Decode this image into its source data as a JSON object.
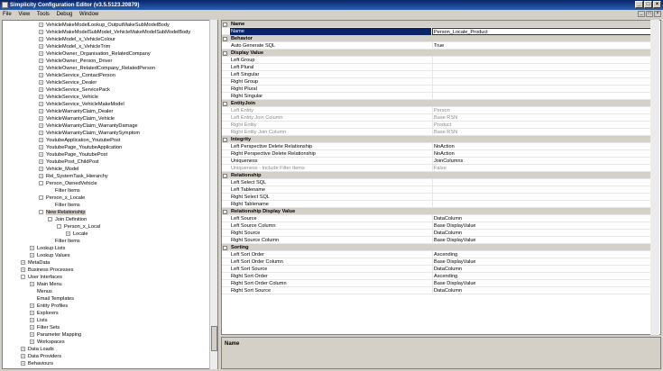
{
  "window": {
    "title": "Simplicity Configuration Editor (v3.5.5123.20879)"
  },
  "menu": [
    "File",
    "View",
    "Tools",
    "Debug",
    "Window"
  ],
  "tree": [
    {
      "label": "VehicleMakeModelLookup_OutputMakeSubModelBody",
      "indent": 2,
      "exp": "+"
    },
    {
      "label": "VehicleMakeModelSubModel_VehicleMakeModelSubModelBody",
      "indent": 2,
      "exp": "+"
    },
    {
      "label": "VehicleModel_x_VehicleColour",
      "indent": 2,
      "exp": "+"
    },
    {
      "label": "VehicleModel_x_VehicleTrim",
      "indent": 2,
      "exp": "+"
    },
    {
      "label": "VehicleOwner_Organisation_RelatedCompany",
      "indent": 2,
      "exp": "+"
    },
    {
      "label": "VehicleOwner_Person_Driver",
      "indent": 2,
      "exp": "+"
    },
    {
      "label": "VehicleOwner_RelatedCompany_RelatedPerson",
      "indent": 2,
      "exp": "+"
    },
    {
      "label": "VehicleService_ContactPerson",
      "indent": 2,
      "exp": "+"
    },
    {
      "label": "VehicleService_Dealer",
      "indent": 2,
      "exp": "+"
    },
    {
      "label": "VehicleService_ServicePack",
      "indent": 2,
      "exp": "+"
    },
    {
      "label": "VehicleService_Vehicle",
      "indent": 2,
      "exp": "+"
    },
    {
      "label": "VehicleService_VehicleMakeModel",
      "indent": 2,
      "exp": "+"
    },
    {
      "label": "VehicleWarrantyClaim_Dealer",
      "indent": 2,
      "exp": "+"
    },
    {
      "label": "VehicleWarrantyClaim_Vehicle",
      "indent": 2,
      "exp": "+"
    },
    {
      "label": "VehicleWarrantyClaim_WarrantyDamage",
      "indent": 2,
      "exp": "+"
    },
    {
      "label": "VehicleWarrantyClaim_WarrantySymptom",
      "indent": 2,
      "exp": "+"
    },
    {
      "label": "YoutubeApplication_YoutubePost",
      "indent": 2,
      "exp": "+"
    },
    {
      "label": "YoutubePage_YoutubeApplication",
      "indent": 2,
      "exp": "+"
    },
    {
      "label": "YoutubePage_YoutubePost",
      "indent": 2,
      "exp": "+"
    },
    {
      "label": "YoutubePost_ChildPost",
      "indent": 2,
      "exp": "+"
    },
    {
      "label": "Vehicle_Model",
      "indent": 2,
      "exp": "+"
    },
    {
      "label": "Rel_SystemTask_Hierarchy",
      "indent": 2,
      "exp": "+"
    },
    {
      "label": "Person_OwnedVehicle",
      "indent": 2,
      "exp": "-"
    },
    {
      "label": "Filter Items",
      "indent": 3,
      "exp": ""
    },
    {
      "label": "Person_x_Locale",
      "indent": 2,
      "exp": "-"
    },
    {
      "label": "Filter Items",
      "indent": 3,
      "exp": ""
    },
    {
      "label": "New Relationship",
      "indent": 2,
      "exp": "-",
      "sel": true
    },
    {
      "label": "Join Definition",
      "indent": 3,
      "exp": "-"
    },
    {
      "label": "Person_x_Local",
      "indent": 4,
      "exp": "-"
    },
    {
      "label": "Locale",
      "indent": 5,
      "exp": "+"
    },
    {
      "label": "Filter Items",
      "indent": 3,
      "exp": ""
    },
    {
      "label": "Lookup Lists",
      "indent": 1,
      "exp": "+"
    },
    {
      "label": "Lookup Values",
      "indent": 1,
      "exp": "+"
    },
    {
      "label": "MetaData",
      "indent": 0,
      "exp": "+"
    },
    {
      "label": "Business Processes",
      "indent": 0,
      "exp": "+"
    },
    {
      "label": "User Interfaces",
      "indent": 0,
      "exp": "-"
    },
    {
      "label": "Main Menu",
      "indent": 1,
      "exp": "+"
    },
    {
      "label": "Menus",
      "indent": 1,
      "exp": ""
    },
    {
      "label": "Email Templates",
      "indent": 1,
      "exp": ""
    },
    {
      "label": "Entity Profiles",
      "indent": 1,
      "exp": "+"
    },
    {
      "label": "Explorers",
      "indent": 1,
      "exp": "+"
    },
    {
      "label": "Lists",
      "indent": 1,
      "exp": "+"
    },
    {
      "label": "Filter Sets",
      "indent": 1,
      "exp": "+"
    },
    {
      "label": "Parameter Mapping",
      "indent": 1,
      "exp": "+"
    },
    {
      "label": "Workspaces",
      "indent": 1,
      "exp": "+"
    },
    {
      "label": "Data Loads",
      "indent": 0,
      "exp": "+"
    },
    {
      "label": "Data Providers",
      "indent": 0,
      "exp": "+"
    },
    {
      "label": "Behaviours",
      "indent": 0,
      "exp": "+"
    }
  ],
  "grid": [
    {
      "type": "cat",
      "key": "Name"
    },
    {
      "key": "Name",
      "value": "Person_Locale_Product",
      "hl": true
    },
    {
      "type": "cat",
      "key": "Behavior"
    },
    {
      "key": "Auto Generate SQL",
      "value": "True"
    },
    {
      "type": "cat",
      "key": "Display Value"
    },
    {
      "key": "Left Group",
      "value": ""
    },
    {
      "key": "Left Plural",
      "value": ""
    },
    {
      "key": "Left Singular",
      "value": ""
    },
    {
      "key": "Right Group",
      "value": ""
    },
    {
      "key": "Right Plural",
      "value": ""
    },
    {
      "key": "Right Singular",
      "value": ""
    },
    {
      "type": "cat",
      "key": "EntityJoin"
    },
    {
      "key": "Left Entity",
      "value": "Person",
      "dim": true
    },
    {
      "key": "Left Entity Join Column",
      "value": "Base RSN",
      "dim": true
    },
    {
      "key": "Right Entity",
      "value": "Product",
      "dim": true
    },
    {
      "key": "Right Entity Join Column",
      "value": "Base RSN",
      "dim": true
    },
    {
      "type": "cat",
      "key": "Integrity"
    },
    {
      "key": "Left Perspective Delete Relationship",
      "value": "NoAction"
    },
    {
      "key": "Right Perspective Delete Relationship",
      "value": "NoAction"
    },
    {
      "key": "Uniqueness",
      "value": "JoinColumns"
    },
    {
      "key": "Uniqueness - Include Filter Items",
      "value": "False",
      "dim": true
    },
    {
      "type": "cat",
      "key": "Relationship"
    },
    {
      "key": "Left Select SQL",
      "value": ""
    },
    {
      "key": "Left Tablename",
      "value": ""
    },
    {
      "key": "Right Select SQL",
      "value": ""
    },
    {
      "key": "Right Tablename",
      "value": ""
    },
    {
      "type": "cat",
      "key": "Relationship Display Value"
    },
    {
      "key": "Left Source",
      "value": "DataColumn"
    },
    {
      "key": "Left Source Column",
      "value": "Base DisplayValue"
    },
    {
      "key": "Right Source",
      "value": "DataColumn"
    },
    {
      "key": "Right Source Column",
      "value": "Base DisplayValue"
    },
    {
      "type": "cat",
      "key": "Sorting"
    },
    {
      "key": "Left Sort Order",
      "value": "Ascending"
    },
    {
      "key": "Left Sort Order Column",
      "value": "Base DisplayValue"
    },
    {
      "key": "Left Sort Source",
      "value": "DataColumn"
    },
    {
      "key": "Right Sort Order",
      "value": "Ascending"
    },
    {
      "key": "Right Sort Order Column",
      "value": "Base DisplayValue"
    },
    {
      "key": "Right Sort Source",
      "value": "DataColumn"
    }
  ],
  "description": {
    "name": "Name"
  }
}
